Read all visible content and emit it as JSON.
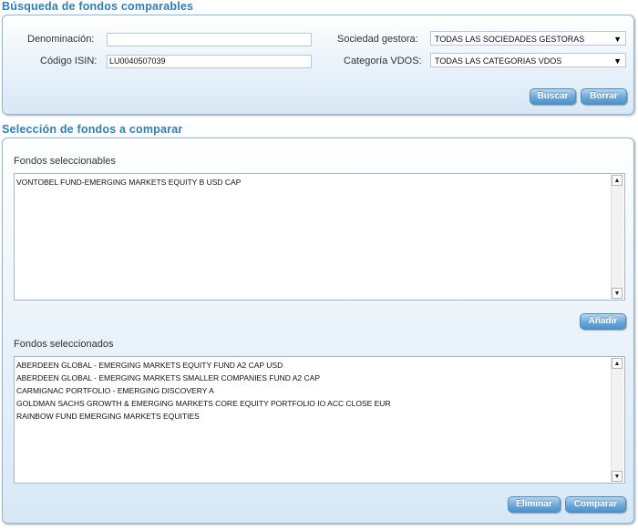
{
  "search": {
    "title": "Búsqueda de fondos comparables",
    "denominacion_label": "Denominación:",
    "denominacion_value": "",
    "isin_label": "Código ISIN:",
    "isin_value": "LU0040507039",
    "sociedad_label": "Sociedad gestora:",
    "sociedad_value": "TODAS LAS SOCIEDADES GESTORAS",
    "categoria_label": "Categoría VDOS:",
    "categoria_value": "TODAS LAS CATEGORIAS VDOS",
    "buscar_label": "Buscar",
    "borrar_label": "Borrar"
  },
  "selection": {
    "title": "Selección de fondos a comparar",
    "seleccionables_label": "Fondos seleccionables",
    "seleccionables": [
      "VONTOBEL FUND-EMERGING MARKETS EQUITY B USD CAP"
    ],
    "anadir_label": "Añadir",
    "seleccionados_label": "Fondos seleccionados",
    "seleccionados": [
      "ABERDEEN GLOBAL - EMERGING MARKETS EQUITY FUND A2 CAP USD",
      "ABERDEEN GLOBAL - EMERGING MARKETS SMALLER COMPANIES FUND A2 CAP",
      "CARMIGNAC PORTFOLIO - EMERGING DISCOVERY A",
      "GOLDMAN SACHS GROWTH & EMERGING MARKETS CORE EQUITY PORTFOLIO IO ACC CLOSE EUR",
      "RAINBOW FUND EMERGING MARKETS EQUITIES"
    ],
    "eliminar_label": "Eliminar",
    "comparar_label": "Comparar"
  },
  "icons": {
    "dropdown": "chevron-down-icon",
    "scroll_up": "scroll-up-icon",
    "scroll_down": "scroll-down-icon"
  }
}
